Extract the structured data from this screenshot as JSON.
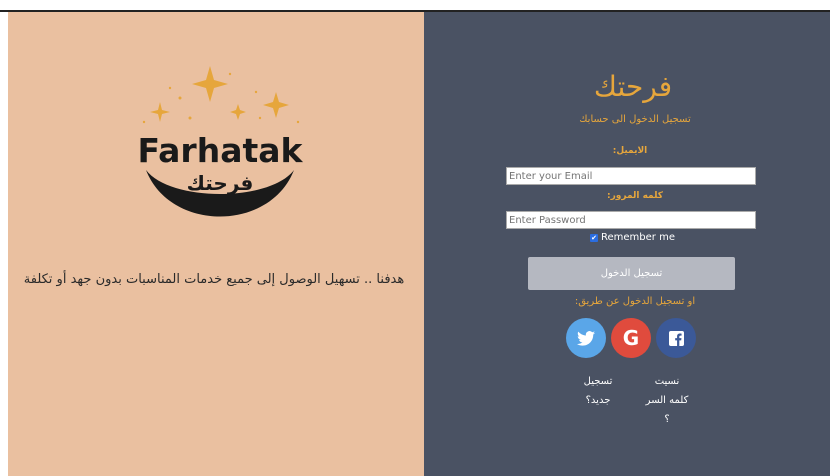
{
  "logo": {
    "latin_text": "Farhatak",
    "arabic_text": "فرحتك",
    "icon": "stars-crown-logo"
  },
  "tagline": "هدفنا .. تسهيل الوصول إلى جميع خدمات المناسبات بدون جهد أو تكلفة",
  "login": {
    "brand": "فرحتك",
    "subtitle": "تسجيل الدخول الى حسابك",
    "email_label": "الايميل:",
    "email_placeholder": "Enter your Email",
    "password_label": "كلمه المرور:",
    "password_placeholder": "Enter Password",
    "remember_label": "Remember me",
    "remember_checked": true,
    "submit_label": "تسجيل الدخول",
    "or_text": "او تسجيل الدخول عن طريق:",
    "social": [
      {
        "name": "twitter",
        "icon": "twitter-icon",
        "color": "#5aa6e8"
      },
      {
        "name": "google",
        "icon": "google-icon",
        "glyph": "G",
        "color": "#e04b3d"
      },
      {
        "name": "facebook",
        "icon": "facebook-icon",
        "color": "#3b5998"
      }
    ],
    "register_link": "تسجيل جديد؟",
    "forgot_link": "نسيت كلمه السر ؟"
  },
  "colors": {
    "left_bg": "#eac0a0",
    "right_bg": "#4a5263",
    "accent": "#e6a63c",
    "button_bg": "#b5b8c1"
  }
}
